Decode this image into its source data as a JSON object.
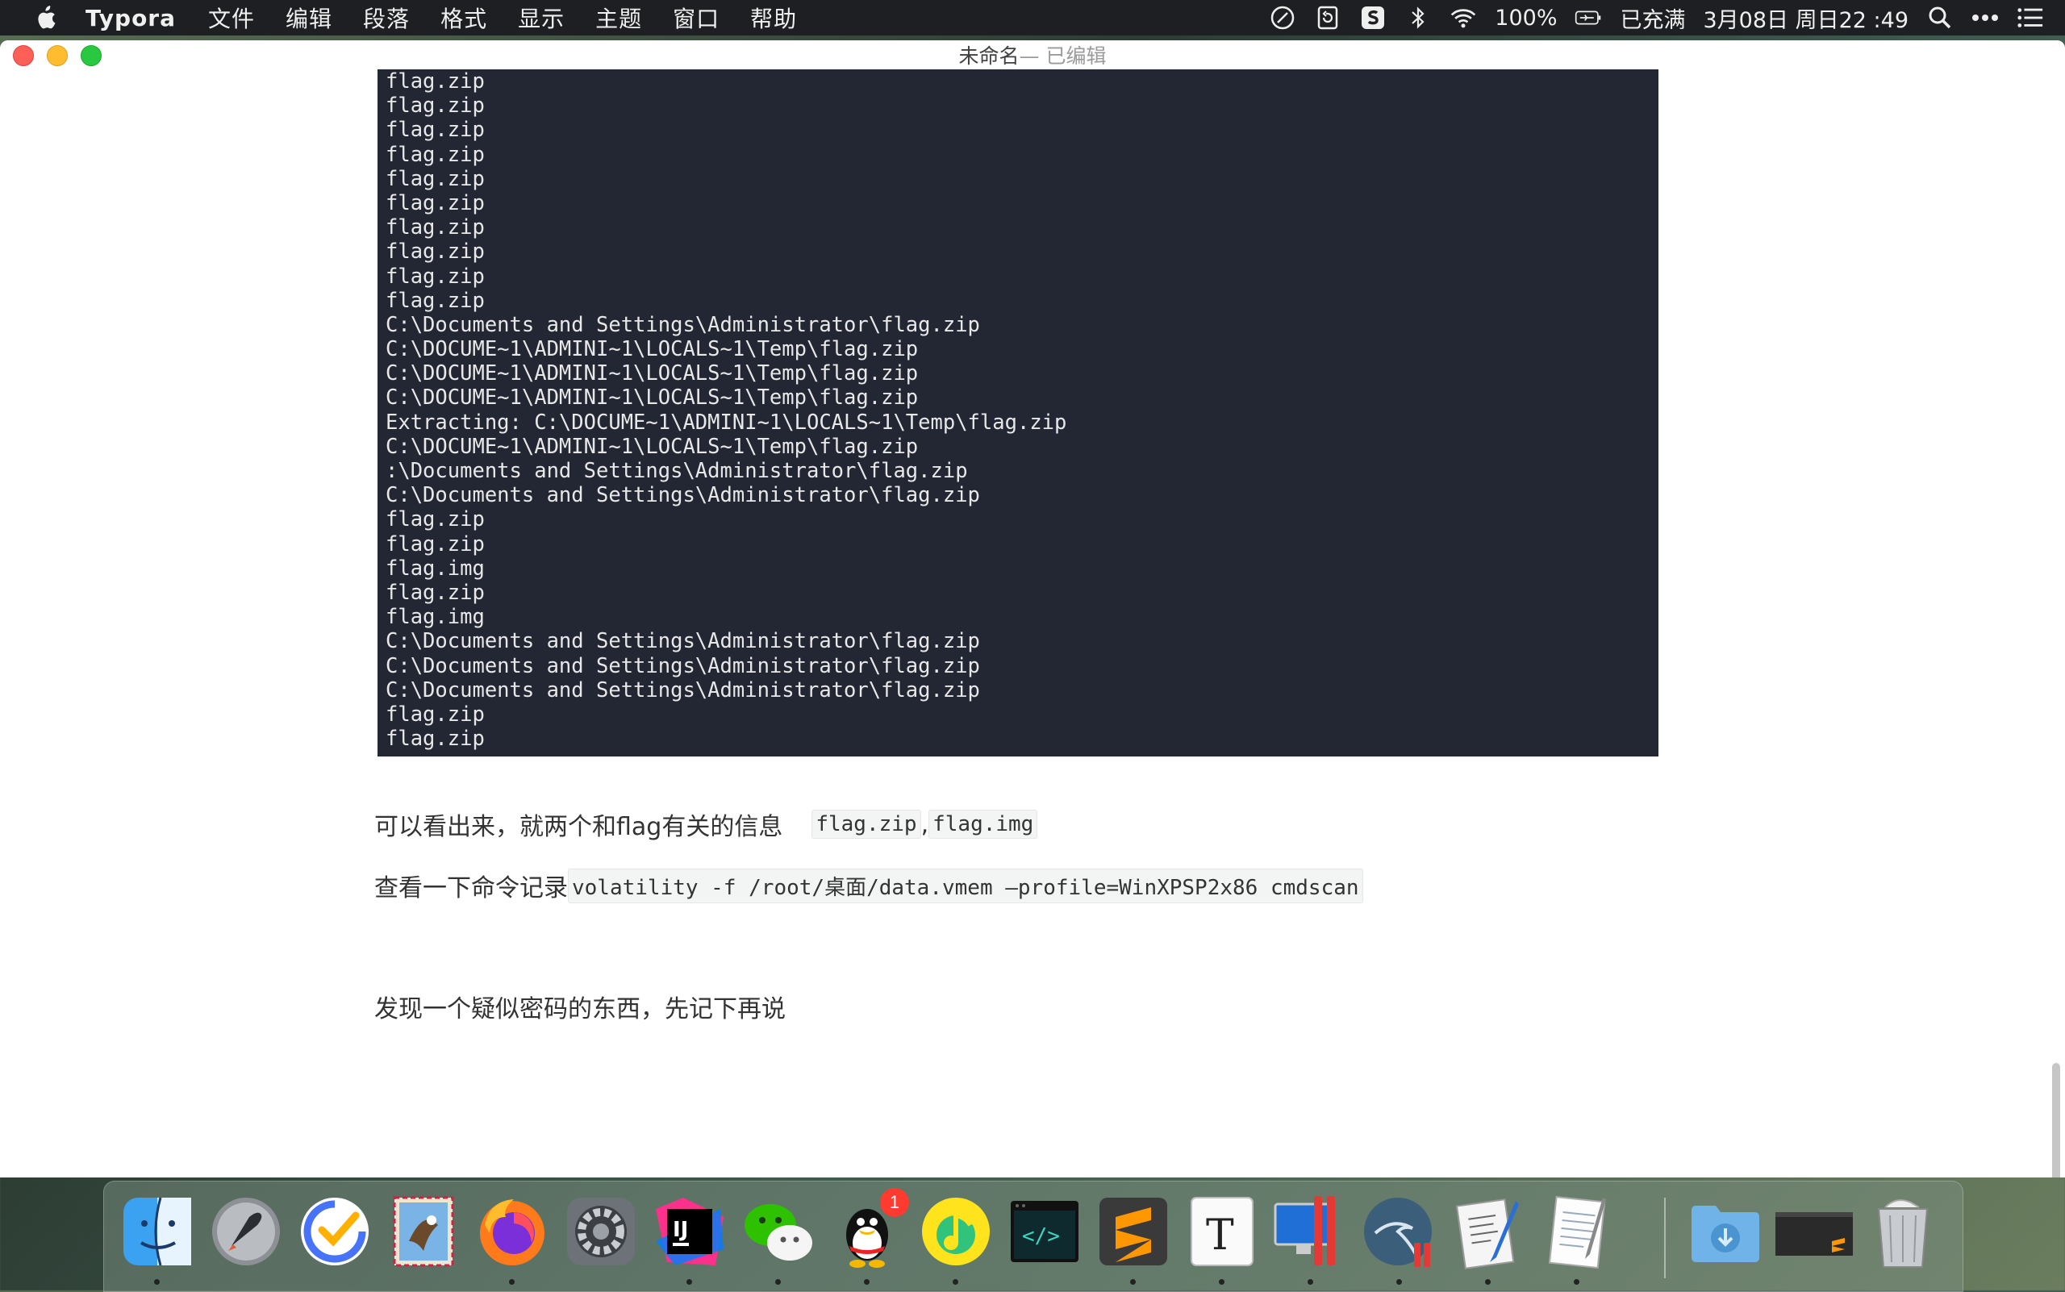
{
  "menubar": {
    "app_name": "Typora",
    "menus": [
      "文件",
      "编辑",
      "段落",
      "格式",
      "显示",
      "主题",
      "窗口",
      "帮助"
    ],
    "battery": "100%",
    "charge_status": "已充满",
    "datetime": "3月08日 周日22 :49"
  },
  "window": {
    "title": "未命名",
    "title_suffix": " — 已编辑"
  },
  "terminal": {
    "lines": [
      "flag.zip",
      "flag.zip",
      "flag.zip",
      "flag.zip",
      "flag.zip",
      "flag.zip",
      "flag.zip",
      "flag.zip",
      "flag.zip",
      "flag.zip",
      "C:\\Documents and Settings\\Administrator\\flag.zip",
      "C:\\DOCUME~1\\ADMINI~1\\LOCALS~1\\Temp\\flag.zip",
      "C:\\DOCUME~1\\ADMINI~1\\LOCALS~1\\Temp\\flag.zip",
      "C:\\DOCUME~1\\ADMINI~1\\LOCALS~1\\Temp\\flag.zip",
      "Extracting: C:\\DOCUME~1\\ADMINI~1\\LOCALS~1\\Temp\\flag.zip",
      "C:\\DOCUME~1\\ADMINI~1\\LOCALS~1\\Temp\\flag.zip",
      ":\\Documents and Settings\\Administrator\\flag.zip",
      "C:\\Documents and Settings\\Administrator\\flag.zip",
      "flag.zip",
      "flag.zip",
      "flag.img",
      "flag.zip",
      "flag.img",
      "C:\\Documents and Settings\\Administrator\\flag.zip",
      "C:\\Documents and Settings\\Administrator\\flag.zip",
      "C:\\Documents and Settings\\Administrator\\flag.zip",
      "flag.zip",
      "flag.zip"
    ]
  },
  "document": {
    "para1_text": "可以看出来，就两个和flag有关的信息",
    "para1_code1": "flag.zip",
    "para1_sep": ",",
    "para1_code2": "flag.img",
    "para2_text": "查看一下命令记录",
    "para2_code": "volatility -f /root/桌面/data.vmem —profile=WinXPSP2x86  cmdscan",
    "para3_text": "发现一个疑似密码的东西，先记下再说"
  },
  "dock": {
    "apps": [
      {
        "name": "Finder",
        "icon": "finder-icon"
      },
      {
        "name": "Launchpad",
        "icon": "launchpad-icon"
      },
      {
        "name": "TickTick",
        "icon": "ticktick-icon"
      },
      {
        "name": "Mail",
        "icon": "mail-icon"
      },
      {
        "name": "Firefox",
        "icon": "firefox-icon"
      },
      {
        "name": "System Preferences",
        "icon": "system-preferences-icon"
      },
      {
        "name": "IntelliJ IDEA",
        "icon": "intellij-icon"
      },
      {
        "name": "WeChat",
        "icon": "wechat-icon"
      },
      {
        "name": "QQ",
        "icon": "qq-icon",
        "badge": "1"
      },
      {
        "name": "QQ Music",
        "icon": "qq-music-icon"
      },
      {
        "name": "Code Editor",
        "icon": "code-editor-icon"
      },
      {
        "name": "Sublime Text",
        "icon": "sublime-text-icon"
      },
      {
        "name": "Typora",
        "icon": "typora-icon"
      },
      {
        "name": "Parallels Desktop",
        "icon": "parallels-icon"
      },
      {
        "name": "Kali Linux",
        "icon": "kali-icon"
      },
      {
        "name": "Script Editor",
        "icon": "script-editor-icon"
      },
      {
        "name": "TextEdit",
        "icon": "textedit-icon"
      },
      {
        "name": "Downloads",
        "icon": "downloads-folder-icon"
      },
      {
        "name": "Terminal Minimized",
        "icon": "minimized-window-icon"
      },
      {
        "name": "Trash",
        "icon": "trash-icon"
      }
    ]
  }
}
